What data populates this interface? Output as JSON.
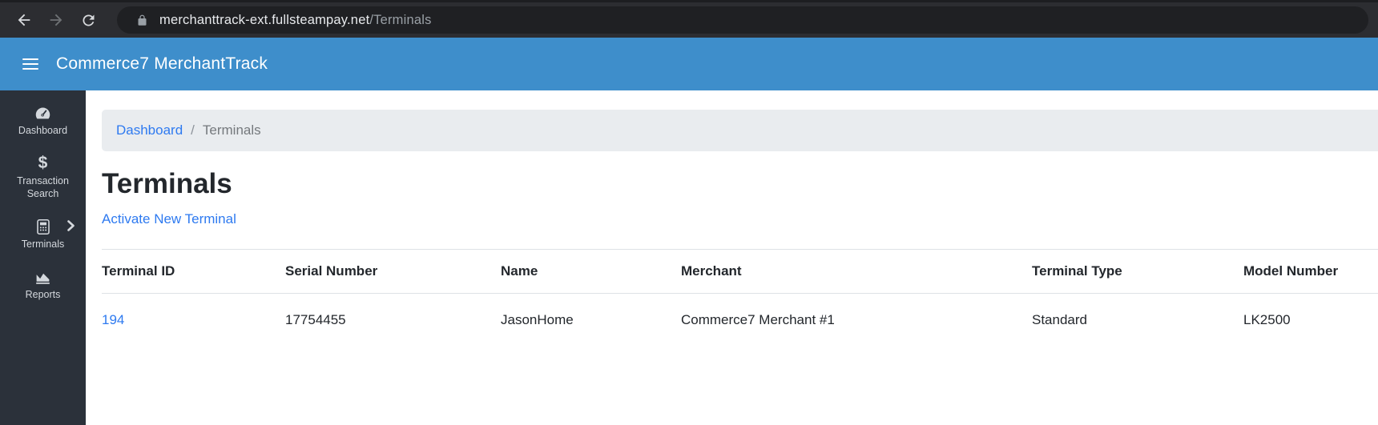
{
  "browser": {
    "url_host": "merchanttrack-ext.fullsteampay.net",
    "url_path": "/Terminals"
  },
  "app_header": {
    "title": "Commerce7 MerchantTrack"
  },
  "sidebar": {
    "items": [
      {
        "label": "Dashboard",
        "icon": "gauge-icon"
      },
      {
        "label": "Transaction Search",
        "icon": "dollar-icon"
      },
      {
        "label": "Terminals",
        "icon": "calculator-icon",
        "has_chevron": true
      },
      {
        "label": "Reports",
        "icon": "chart-area-icon"
      }
    ]
  },
  "breadcrumb": {
    "link": "Dashboard",
    "separator": "/",
    "current": "Terminals"
  },
  "page": {
    "title": "Terminals",
    "action_link": "Activate New Terminal"
  },
  "table": {
    "headers": [
      "Terminal ID",
      "Serial Number",
      "Name",
      "Merchant",
      "Terminal Type",
      "Model Number"
    ],
    "rows": [
      {
        "terminal_id": "194",
        "serial_number": "17754455",
        "name": "JasonHome",
        "merchant": "Commerce7 Merchant #1",
        "terminal_type": "Standard",
        "model_number": "LK2500"
      }
    ]
  },
  "colors": {
    "app_bar_blue": "#3e8ecb",
    "sidebar_dark": "#2b313a",
    "accent_link_blue": "#2e7af0",
    "breadcrumb_bg": "#e9ecef",
    "chrome_bg": "#2c2d31",
    "omnibox_bg": "#1f2023"
  }
}
